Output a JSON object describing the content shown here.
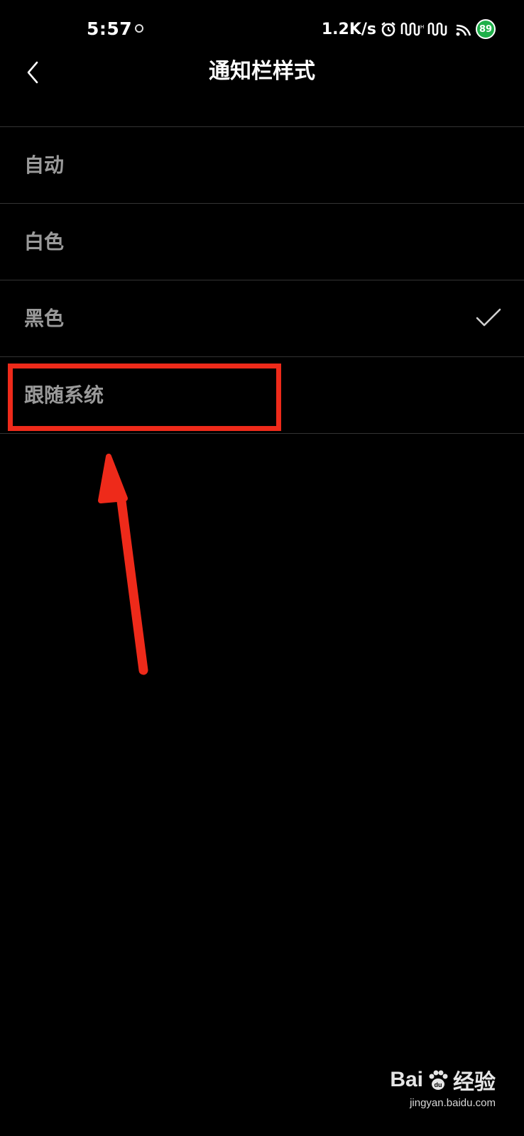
{
  "status_bar": {
    "time": "5:57",
    "network_speed": "1.2K/s",
    "battery": "89",
    "icons": [
      "alarm-icon",
      "signal-hd-icon",
      "signal-hd-icon",
      "wifi-icon",
      "battery-icon"
    ]
  },
  "header": {
    "title": "通知栏样式",
    "back_icon": "chevron-left-icon"
  },
  "options": [
    {
      "label": "自动",
      "selected": false
    },
    {
      "label": "白色",
      "selected": false
    },
    {
      "label": "黑色",
      "selected": true
    },
    {
      "label": "跟随系统",
      "selected": false
    }
  ],
  "watermark": {
    "logo_text": "Bai",
    "logo_text2": "经验",
    "url": "jingyan.baidu.com"
  },
  "colors": {
    "background": "#000000",
    "annotation": "#ee2a1a",
    "option_text": "#9a9a9a",
    "battery": "#1fb04a"
  }
}
